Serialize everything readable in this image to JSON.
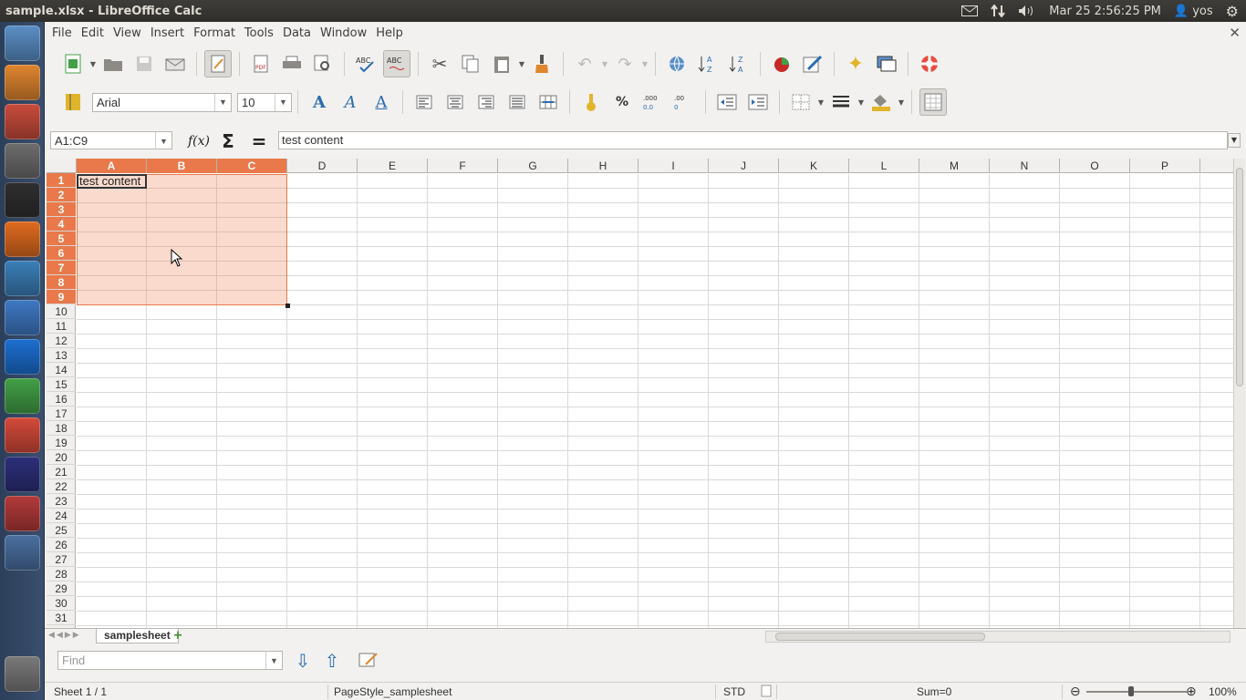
{
  "window": {
    "title": "sample.xlsx - LibreOffice Calc"
  },
  "topbar": {
    "date_time": "Mar 25  2:56:25 PM",
    "user": "yos"
  },
  "launcher": [
    {
      "name": "dash-home-icon",
      "color": "#5b8fc7"
    },
    {
      "name": "files-icon",
      "color": "#e0862f"
    },
    {
      "name": "system-settings-icon",
      "color": "#c94c3c"
    },
    {
      "name": "help-icon",
      "color": "#6d6d6d"
    },
    {
      "name": "terminal-icon",
      "color": "#2f2f2f"
    },
    {
      "name": "firefox-icon",
      "color": "#e06b1f"
    },
    {
      "name": "mysql-workbench-icon",
      "color": "#3b7fb8"
    },
    {
      "name": "thunderbird-icon",
      "color": "#3f79c4"
    },
    {
      "name": "teamviewer-icon",
      "color": "#1c6fd1"
    },
    {
      "name": "libreoffice-calc-icon",
      "color": "#43a047"
    },
    {
      "name": "chrome-icon",
      "color": "#d44a3a"
    },
    {
      "name": "eclipse-icon",
      "color": "#2c2f7a"
    },
    {
      "name": "python-icon",
      "color": "#b33a3a"
    },
    {
      "name": "workspace-switcher-icon",
      "color": "#4a6fa0"
    },
    {
      "name": "trash-icon",
      "color": "#7a7a7a"
    }
  ],
  "menu": [
    "File",
    "Edit",
    "View",
    "Insert",
    "Format",
    "Tools",
    "Data",
    "Window",
    "Help"
  ],
  "font": {
    "name": "Arial",
    "size": "10"
  },
  "formula": {
    "name_box": "A1:C9",
    "content": "test content"
  },
  "columns": [
    "A",
    "B",
    "C",
    "D",
    "E",
    "F",
    "G",
    "H",
    "I",
    "J",
    "K",
    "L",
    "M",
    "N",
    "O",
    "P"
  ],
  "selected_columns": [
    "A",
    "B",
    "C"
  ],
  "rows": [
    "1",
    "2",
    "3",
    "4",
    "5",
    "6",
    "7",
    "8",
    "9",
    "10",
    "11",
    "12",
    "13",
    "14",
    "15",
    "16",
    "17",
    "18",
    "19",
    "20",
    "21",
    "22",
    "23",
    "24",
    "25",
    "26",
    "27",
    "28",
    "29",
    "30",
    "31"
  ],
  "selected_rows": [
    "1",
    "2",
    "3",
    "4",
    "5",
    "6",
    "7",
    "8",
    "9"
  ],
  "cells": {
    "A1": "test content"
  },
  "sheet_tab": "samplesheet",
  "find": {
    "placeholder": "Find"
  },
  "status": {
    "sheet": "Sheet 1 / 1",
    "page_style": "PageStyle_samplesheet",
    "mode": "STD",
    "sum": "Sum=0",
    "zoom": "100%"
  },
  "colors": {
    "selection_accent": "#e9794b"
  }
}
